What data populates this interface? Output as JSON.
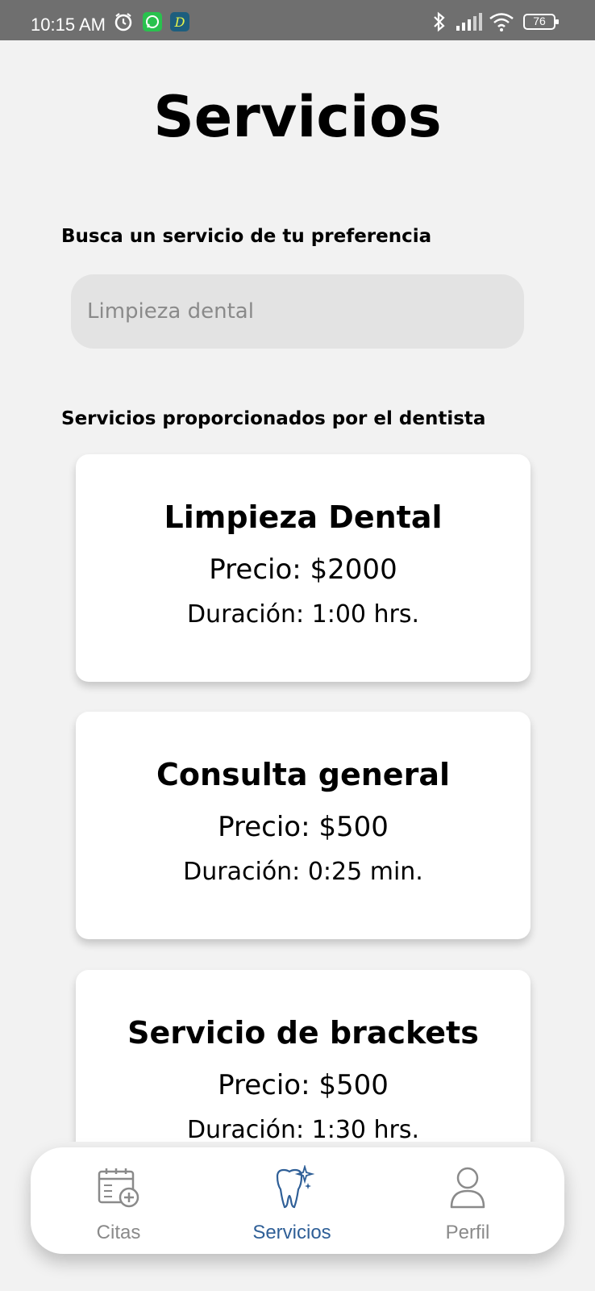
{
  "status_bar": {
    "time": "10:15 AM",
    "battery": "76",
    "icons": [
      "alarm-icon",
      "whatsapp-icon",
      "app-d-icon",
      "bluetooth-icon",
      "signal-icon",
      "wifi-icon",
      "battery-icon"
    ]
  },
  "page": {
    "title": "Servicios"
  },
  "search": {
    "label": "Busca un servicio de tu preferencia",
    "placeholder": "Limpieza dental"
  },
  "services": {
    "label": "Servicios proporcionados por el dentista",
    "items": [
      {
        "name": "Limpieza Dental",
        "price": "Precio: $2000",
        "duration": "Duración: 1:00 hrs."
      },
      {
        "name": "Consulta general",
        "price": "Precio: $500",
        "duration": "Duración: 0:25 min."
      },
      {
        "name": "Servicio de brackets",
        "price": "Precio: $500",
        "duration": "Duración: 1:30 hrs."
      }
    ]
  },
  "nav": {
    "items": [
      {
        "label": "Citas",
        "icon": "calendar-plus-icon",
        "active": false
      },
      {
        "label": "Servicios",
        "icon": "tooth-sparkle-icon",
        "active": true
      },
      {
        "label": "Perfil",
        "icon": "user-icon",
        "active": false
      }
    ]
  },
  "colors": {
    "status_bar": "#6f6f6f",
    "background": "#f2f2f2",
    "active_nav": "#2f5f97",
    "inactive_nav": "#8a8a8a"
  }
}
